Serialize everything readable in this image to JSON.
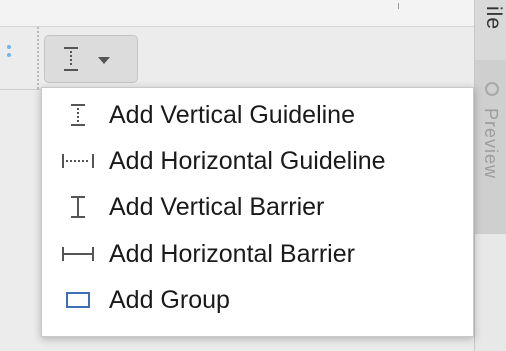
{
  "toolbar": {
    "guideline_button": {
      "icon": "vertical-guideline-icon",
      "dropdown_icon": "chevron-down-icon"
    }
  },
  "side_panel": {
    "top_tab_label": "ile",
    "preview_tab_label": "Preview"
  },
  "menu": {
    "items": [
      {
        "label": "Add Vertical Guideline",
        "icon": "vertical-guideline-icon"
      },
      {
        "label": "Add Horizontal Guideline",
        "icon": "horizontal-guideline-icon"
      },
      {
        "label": "Add Vertical Barrier",
        "icon": "vertical-barrier-icon"
      },
      {
        "label": "Add Horizontal Barrier",
        "icon": "horizontal-barrier-icon"
      },
      {
        "label": "Add Group",
        "icon": "group-icon"
      }
    ]
  },
  "colors": {
    "icon_stroke": "#555555",
    "group_icon_stroke": "#3c6fb5",
    "menu_background": "#ffffff",
    "toolbar_background": "#ececec"
  }
}
